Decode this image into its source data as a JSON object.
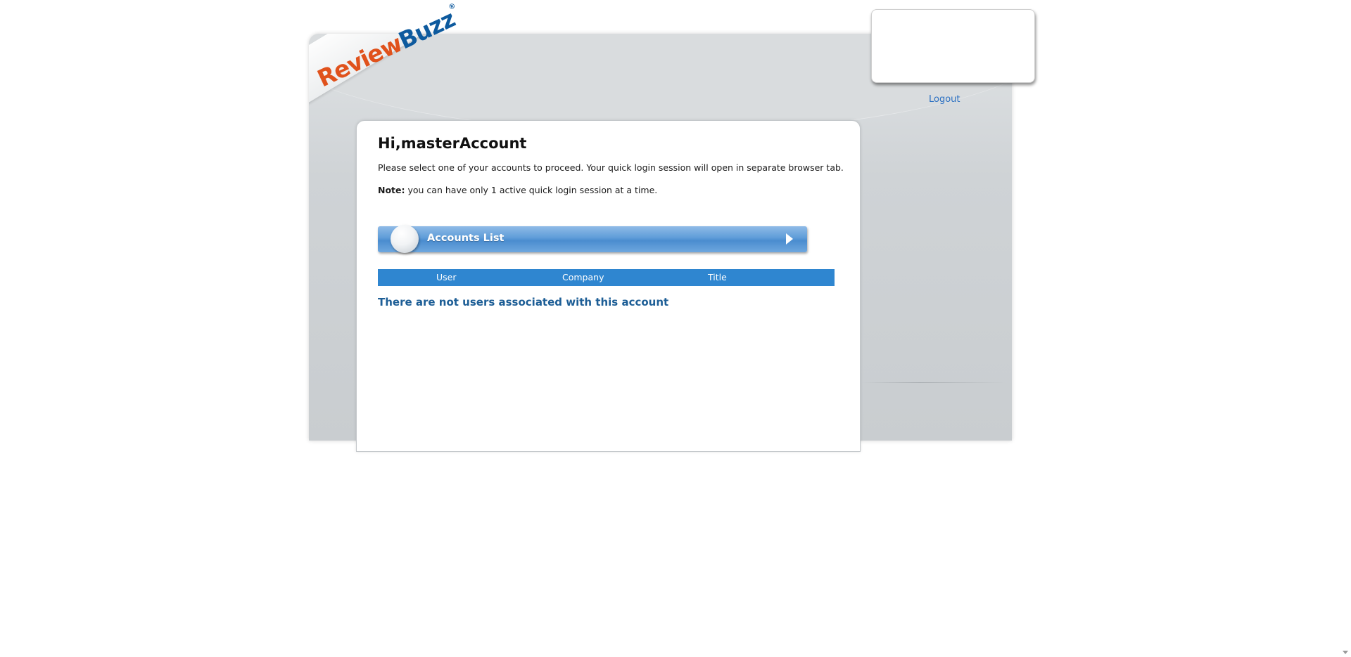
{
  "brand": {
    "logo_review": "Review",
    "logo_buzz": "Buzz",
    "logo_registered": "®"
  },
  "header": {
    "logout_label": "Logout"
  },
  "main": {
    "greeting": "Hi,masterAccount",
    "instructions": "Please select one of your accounts to proceed. Your quick login session will open in separate browser tab.",
    "note_label": "Note:",
    "note_text": " you can have only 1 active quick login session at a time.",
    "accounts_section_title": "Accounts List",
    "table": {
      "columns": [
        "User",
        "Company",
        "Title"
      ]
    },
    "empty_message": "There are not users associated with this account"
  },
  "colors": {
    "logo_review": "#e0521c",
    "logo_buzz": "#0d5a9e",
    "link": "#2a6fc2",
    "table_header_bg": "#2f86d0",
    "empty_message": "#1d5e96"
  },
  "icons": {
    "accounts_bar_ball": "sphere-icon",
    "accounts_bar_arrow": "play-arrow-icon",
    "scroll_down": "chevron-down-icon"
  }
}
